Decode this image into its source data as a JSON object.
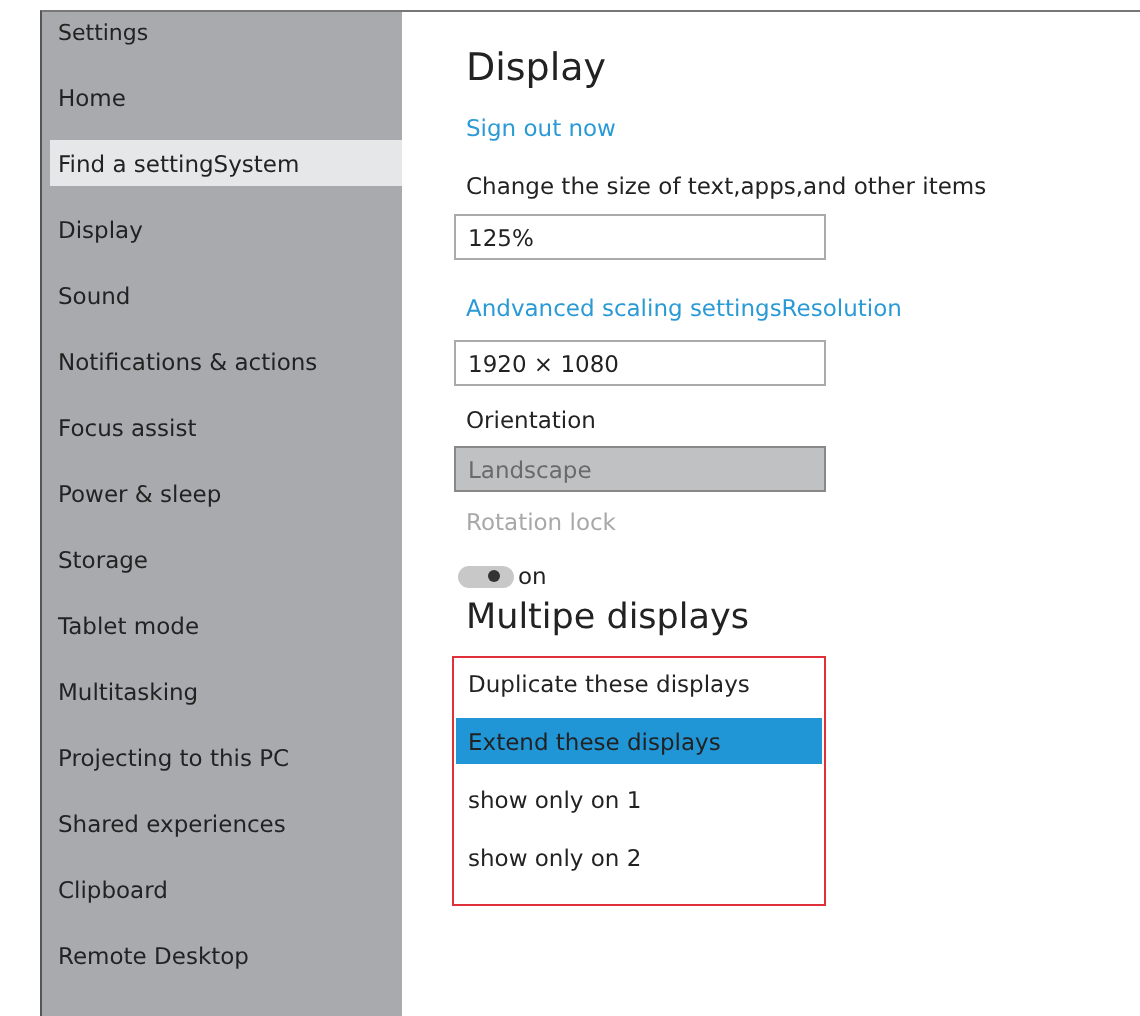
{
  "sidebar": {
    "title": "Settings",
    "items": [
      {
        "label": "Home",
        "selected": false
      },
      {
        "label": "Find a settingSystem",
        "selected": true
      },
      {
        "label": "Display",
        "selected": false
      },
      {
        "label": "Sound",
        "selected": false
      },
      {
        "label": "Notifications & actions",
        "selected": false
      },
      {
        "label": "Focus assist",
        "selected": false
      },
      {
        "label": "Power & sleep",
        "selected": false
      },
      {
        "label": "Storage",
        "selected": false
      },
      {
        "label": "Tablet mode",
        "selected": false
      },
      {
        "label": "Multitasking",
        "selected": false
      },
      {
        "label": "Projecting to this PC",
        "selected": false
      },
      {
        "label": "Shared experiences",
        "selected": false
      },
      {
        "label": "Clipboard",
        "selected": false
      },
      {
        "label": "Remote Desktop",
        "selected": false
      }
    ]
  },
  "main": {
    "title": "Display",
    "sign_out_link": "Sign out now",
    "scale_label": "Change the size of text,apps,and other items",
    "scale_value": "125%",
    "advanced_link": "Andvanced scaling settingsResolution",
    "resolution_value": "1920 × 1080",
    "orientation_label": "Orientation",
    "orientation_value": "Landscape",
    "orientation_disabled": true,
    "rotation_lock_label": "Rotation lock",
    "rotation_lock_disabled": true,
    "toggle": {
      "on": true,
      "label": "on"
    },
    "multiple_title": "Multipe displays",
    "display_options": [
      {
        "label": "Duplicate these displays",
        "selected": false
      },
      {
        "label": "Extend these displays",
        "selected": true
      },
      {
        "label": "show only on 1",
        "selected": false
      },
      {
        "label": "show only on 2",
        "selected": false
      }
    ]
  }
}
